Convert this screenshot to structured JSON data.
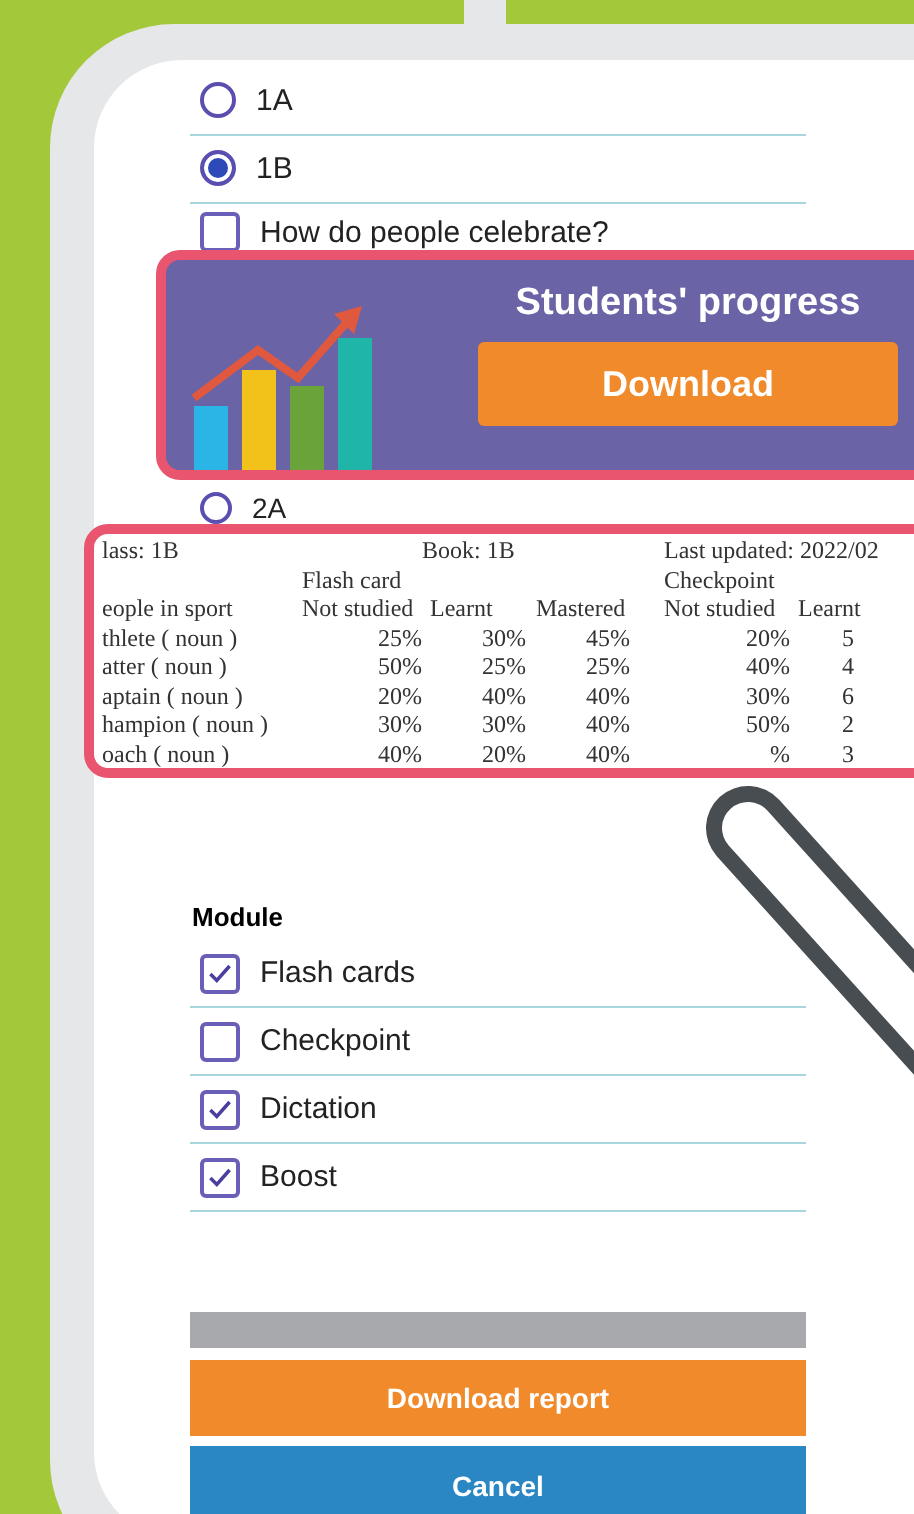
{
  "radios_top": [
    {
      "label": "1A",
      "selected": false
    },
    {
      "label": "1B",
      "selected": true
    }
  ],
  "topic": {
    "label": "How do people celebrate?",
    "checked": false
  },
  "banner": {
    "title": "Students' progress",
    "button": "Download"
  },
  "radios_bottom": [
    {
      "label": "2A",
      "selected": false
    }
  ],
  "report_preview": {
    "class": "lass: 1B",
    "book": "Book: 1B",
    "updated": "Last updated: 2022/02",
    "groups": [
      "Flash card",
      "Checkpoint"
    ],
    "unit": "eople in sport",
    "columns": [
      "Not studied",
      "Learnt",
      "Mastered",
      "Not studied",
      "Learnt"
    ],
    "rows": [
      {
        "word": "thlete ( noun )",
        "cells": [
          "25%",
          "30%",
          "45%",
          "20%",
          "5"
        ]
      },
      {
        "word": "atter ( noun )",
        "cells": [
          "50%",
          "25%",
          "25%",
          "40%",
          "4"
        ]
      },
      {
        "word": "aptain ( noun )",
        "cells": [
          "20%",
          "40%",
          "40%",
          "30%",
          "6"
        ]
      },
      {
        "word": "hampion ( noun )",
        "cells": [
          "30%",
          "30%",
          "40%",
          "50%",
          "2"
        ]
      },
      {
        "word": "oach ( noun )",
        "cells": [
          "40%",
          "20%",
          "40%",
          "%",
          "3"
        ]
      }
    ]
  },
  "module": {
    "title": "Module",
    "items": [
      {
        "label": "Flash cards",
        "checked": true
      },
      {
        "label": "Checkpoint",
        "checked": false
      },
      {
        "label": "Dictation",
        "checked": true
      },
      {
        "label": "Boost",
        "checked": true
      }
    ]
  },
  "actions": {
    "download": "Download report",
    "cancel": "Cancel"
  }
}
